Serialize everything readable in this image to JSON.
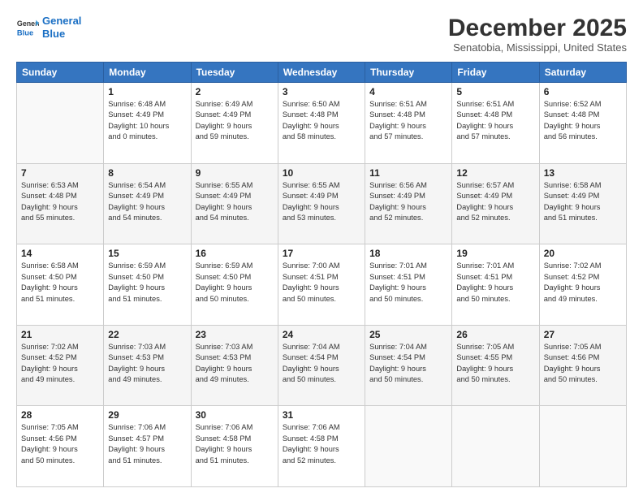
{
  "logo": {
    "line1": "General",
    "line2": "Blue"
  },
  "title": "December 2025",
  "location": "Senatobia, Mississippi, United States",
  "days_header": [
    "Sunday",
    "Monday",
    "Tuesday",
    "Wednesday",
    "Thursday",
    "Friday",
    "Saturday"
  ],
  "weeks": [
    [
      {
        "day": "",
        "info": ""
      },
      {
        "day": "1",
        "info": "Sunrise: 6:48 AM\nSunset: 4:49 PM\nDaylight: 10 hours\nand 0 minutes."
      },
      {
        "day": "2",
        "info": "Sunrise: 6:49 AM\nSunset: 4:49 PM\nDaylight: 9 hours\nand 59 minutes."
      },
      {
        "day": "3",
        "info": "Sunrise: 6:50 AM\nSunset: 4:48 PM\nDaylight: 9 hours\nand 58 minutes."
      },
      {
        "day": "4",
        "info": "Sunrise: 6:51 AM\nSunset: 4:48 PM\nDaylight: 9 hours\nand 57 minutes."
      },
      {
        "day": "5",
        "info": "Sunrise: 6:51 AM\nSunset: 4:48 PM\nDaylight: 9 hours\nand 57 minutes."
      },
      {
        "day": "6",
        "info": "Sunrise: 6:52 AM\nSunset: 4:48 PM\nDaylight: 9 hours\nand 56 minutes."
      }
    ],
    [
      {
        "day": "7",
        "info": "Sunrise: 6:53 AM\nSunset: 4:48 PM\nDaylight: 9 hours\nand 55 minutes."
      },
      {
        "day": "8",
        "info": "Sunrise: 6:54 AM\nSunset: 4:49 PM\nDaylight: 9 hours\nand 54 minutes."
      },
      {
        "day": "9",
        "info": "Sunrise: 6:55 AM\nSunset: 4:49 PM\nDaylight: 9 hours\nand 54 minutes."
      },
      {
        "day": "10",
        "info": "Sunrise: 6:55 AM\nSunset: 4:49 PM\nDaylight: 9 hours\nand 53 minutes."
      },
      {
        "day": "11",
        "info": "Sunrise: 6:56 AM\nSunset: 4:49 PM\nDaylight: 9 hours\nand 52 minutes."
      },
      {
        "day": "12",
        "info": "Sunrise: 6:57 AM\nSunset: 4:49 PM\nDaylight: 9 hours\nand 52 minutes."
      },
      {
        "day": "13",
        "info": "Sunrise: 6:58 AM\nSunset: 4:49 PM\nDaylight: 9 hours\nand 51 minutes."
      }
    ],
    [
      {
        "day": "14",
        "info": "Sunrise: 6:58 AM\nSunset: 4:50 PM\nDaylight: 9 hours\nand 51 minutes."
      },
      {
        "day": "15",
        "info": "Sunrise: 6:59 AM\nSunset: 4:50 PM\nDaylight: 9 hours\nand 51 minutes."
      },
      {
        "day": "16",
        "info": "Sunrise: 6:59 AM\nSunset: 4:50 PM\nDaylight: 9 hours\nand 50 minutes."
      },
      {
        "day": "17",
        "info": "Sunrise: 7:00 AM\nSunset: 4:51 PM\nDaylight: 9 hours\nand 50 minutes."
      },
      {
        "day": "18",
        "info": "Sunrise: 7:01 AM\nSunset: 4:51 PM\nDaylight: 9 hours\nand 50 minutes."
      },
      {
        "day": "19",
        "info": "Sunrise: 7:01 AM\nSunset: 4:51 PM\nDaylight: 9 hours\nand 50 minutes."
      },
      {
        "day": "20",
        "info": "Sunrise: 7:02 AM\nSunset: 4:52 PM\nDaylight: 9 hours\nand 49 minutes."
      }
    ],
    [
      {
        "day": "21",
        "info": "Sunrise: 7:02 AM\nSunset: 4:52 PM\nDaylight: 9 hours\nand 49 minutes."
      },
      {
        "day": "22",
        "info": "Sunrise: 7:03 AM\nSunset: 4:53 PM\nDaylight: 9 hours\nand 49 minutes."
      },
      {
        "day": "23",
        "info": "Sunrise: 7:03 AM\nSunset: 4:53 PM\nDaylight: 9 hours\nand 49 minutes."
      },
      {
        "day": "24",
        "info": "Sunrise: 7:04 AM\nSunset: 4:54 PM\nDaylight: 9 hours\nand 50 minutes."
      },
      {
        "day": "25",
        "info": "Sunrise: 7:04 AM\nSunset: 4:54 PM\nDaylight: 9 hours\nand 50 minutes."
      },
      {
        "day": "26",
        "info": "Sunrise: 7:05 AM\nSunset: 4:55 PM\nDaylight: 9 hours\nand 50 minutes."
      },
      {
        "day": "27",
        "info": "Sunrise: 7:05 AM\nSunset: 4:56 PM\nDaylight: 9 hours\nand 50 minutes."
      }
    ],
    [
      {
        "day": "28",
        "info": "Sunrise: 7:05 AM\nSunset: 4:56 PM\nDaylight: 9 hours\nand 50 minutes."
      },
      {
        "day": "29",
        "info": "Sunrise: 7:06 AM\nSunset: 4:57 PM\nDaylight: 9 hours\nand 51 minutes."
      },
      {
        "day": "30",
        "info": "Sunrise: 7:06 AM\nSunset: 4:58 PM\nDaylight: 9 hours\nand 51 minutes."
      },
      {
        "day": "31",
        "info": "Sunrise: 7:06 AM\nSunset: 4:58 PM\nDaylight: 9 hours\nand 52 minutes."
      },
      {
        "day": "",
        "info": ""
      },
      {
        "day": "",
        "info": ""
      },
      {
        "day": "",
        "info": ""
      }
    ]
  ]
}
